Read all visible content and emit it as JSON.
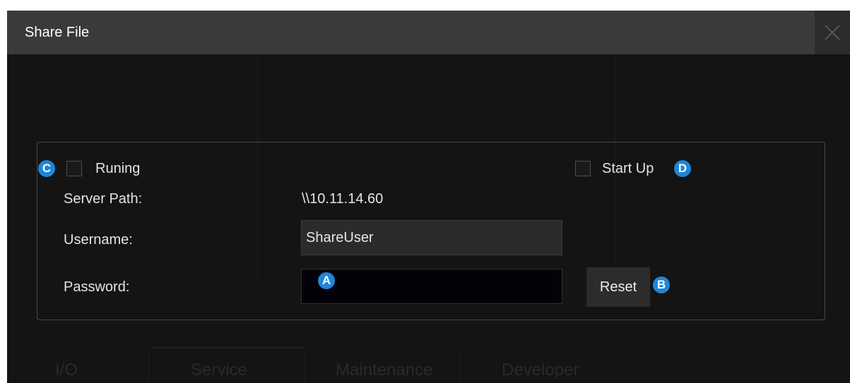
{
  "dialog": {
    "title": "Share File",
    "close_icon": "close-icon"
  },
  "form": {
    "running_label": "Runing",
    "running_checked": false,
    "startup_label": "Start Up",
    "startup_checked": false,
    "server_path_label": "Server Path:",
    "server_path_value": "\\\\10.11.14.60",
    "username_label": "Username:",
    "username_value": "ShareUser",
    "password_label": "Password:",
    "password_value": "",
    "reset_label": "Reset"
  },
  "callouts": {
    "a": "A",
    "b": "B",
    "c": "C",
    "d": "D"
  },
  "background_tabs": [
    "I/O",
    "Service",
    "Maintenance",
    "Developer"
  ],
  "colors": {
    "dialog_bg": "#141414",
    "title_bar": "#3a3a3a",
    "badge": "#1e86d8"
  }
}
